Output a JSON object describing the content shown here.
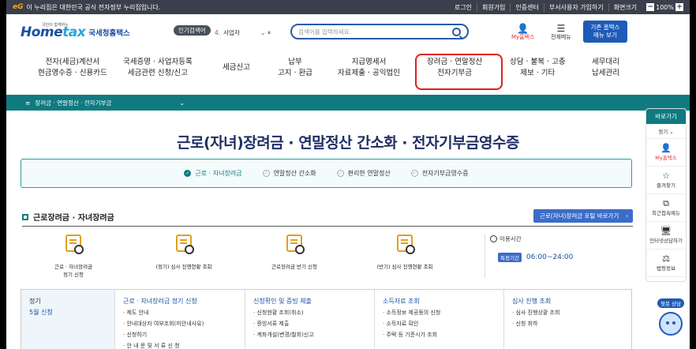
{
  "govbar": {
    "brand": "eG",
    "notice": "이 누리집은 대한민국 공식 전자정부 누리집입니다.",
    "links": [
      "로그인",
      "회원가입",
      "인증센터",
      "부서사용자 가입하기",
      "화면크기"
    ],
    "zoom": "100%"
  },
  "header": {
    "logo_small": "국민이 함께하는",
    "logo_mark_a": "Home",
    "logo_mark_b": "tax",
    "logo_sub": "국세청홈택스",
    "popular_label": "인기검색어",
    "popular_num": "4.",
    "popular_item": "사업자",
    "search_placeholder": "검색어를 입력하세요.",
    "my_label": "My홈택스",
    "menu_label": "전체메뉴",
    "old_btn_line1": "기존 홈택스",
    "old_btn_line2": "메뉴 보기"
  },
  "nav": [
    {
      "l1": "전자(세금)계산서",
      "l2": "현금영수증 · 신용카드"
    },
    {
      "l1": "국세증명 · 사업자등록",
      "l2": "세금관련 신청/신고"
    },
    {
      "l1": "세금신고",
      "l2": ""
    },
    {
      "l1": "납부",
      "l2": "고지 · 환급"
    },
    {
      "l1": "지급명세서",
      "l2": "자료제출 · 공익법인"
    },
    {
      "l1": "장려금 · 연말정산",
      "l2": "전자기부금"
    },
    {
      "l1": "상담 · 불복 · 고충",
      "l2": "제보 · 기타"
    },
    {
      "l1": "세무대리",
      "l2": "납세관리"
    }
  ],
  "crumb": {
    "label": "장려금 · 연말정산 · 전자기부금"
  },
  "page_title": "근로(자녀)장려금 · 연말정산 간소화 · 전자기부금영수증",
  "tabs": [
    "근로 · 자녀장려금",
    "연말정산 간소화",
    "편리한 연말정산",
    "전자기부금영수증"
  ],
  "section": {
    "title": "근로장려금 · 자녀장려금",
    "portal_btn": "근로(자녀)장려금 포털 바로가기"
  },
  "cards": [
    {
      "l1": "근로 · 자녀장려금",
      "l2": "정기 신청"
    },
    {
      "l1": "(정기) 심사 진행현황 조회",
      "l2": ""
    },
    {
      "l1": "근로장려금 반기 신청",
      "l2": ""
    },
    {
      "l1": "(반기) 심사 진행현황 조회",
      "l2": ""
    }
  ],
  "hours": {
    "label": "이용시간",
    "badge": "특정기간",
    "time": "06:00~24:00"
  },
  "table": [
    {
      "h": "정기",
      "sub": "5월 신청",
      "items": []
    },
    {
      "h": "근로 · 자녀장려금 정기 신청",
      "items": [
        "· 제도 안내",
        "· 안내대상자 여부조회(미안내사유)",
        "· 신청하기",
        "· 안 내 문 및 서 류 신 청"
      ]
    },
    {
      "h": "신청확인 및 증빙 제출",
      "items": [
        "· 신청현황 조회(취소)",
        "· 증빙서류 제출",
        "· 계좌개설(변경/철회)신고"
      ]
    },
    {
      "h": "소득자료 조회",
      "items": [
        "· 소득정보 제공동의 신청",
        "· 소득자료 확인",
        "· 주택 등 기준시가 조회"
      ]
    },
    {
      "h": "심사 진행 조회",
      "items": [
        "· 심사 진행상황 조회",
        "· 신청 취하"
      ]
    }
  ],
  "quick": {
    "title": "바로가기",
    "select": "정기",
    "items": [
      "My홈택스",
      "즐겨찾기",
      "최근접속메뉴",
      "인터넷상담하기",
      "법령정보"
    ]
  },
  "chatbot": {
    "label": "챗봇 상담"
  },
  "colors": {
    "teal": "#0f7a80",
    "blue": "#1e5bb8",
    "highlight": "#e02020"
  }
}
